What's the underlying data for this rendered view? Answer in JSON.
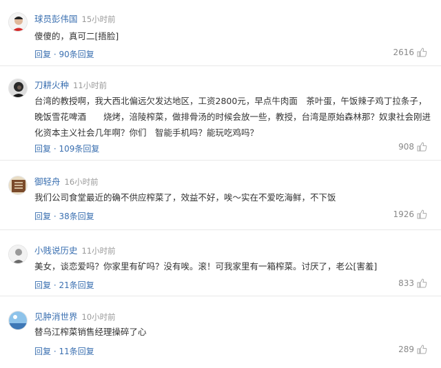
{
  "comments": [
    {
      "username": "球员彭伟国",
      "time": "15小时前",
      "content": "傻傻的，真可二[捂脸]",
      "reply_label": "回复 · 90条回复",
      "likes": "2616",
      "avatar_icon": "person-red-shirt-avatar"
    },
    {
      "username": "刀耕火种",
      "time": "11小时前",
      "content": "台湾的教授啊，我大西北偏远欠发达地区，工资2800元，早点牛肉面　茶叶蛋，午饭辣子鸡丁拉条子，晚饭雪花啤酒　　烧烤，涪陵榨菜，做排骨汤的时候会放一些，教授，台湾是原始森林那？奴隶社会刚进化资本主义社会几年啊？你们　智能手机吗？能玩吃鸡吗？",
      "reply_label": "回复 · 109条回复",
      "likes": "908",
      "avatar_icon": "dark-portrait-avatar"
    },
    {
      "username": "御轻舟",
      "time": "16小时前",
      "content": "我们公司食堂最近的确不供应榨菜了，效益不好，唉～实在不爱吃海鲜，不下饭",
      "reply_label": "回复 · 38条回复",
      "likes": "1926",
      "avatar_icon": "calligraphy-avatar"
    },
    {
      "username": "小贱说历史",
      "time": "11小时前",
      "content": "美女，谈恋爱吗？你家里有矿吗？没有唉。滚！可我家里有一箱榨菜。讨厌了，老公[害羞]",
      "reply_label": "回复 · 21条回复",
      "likes": "833",
      "avatar_icon": "grey-figure-avatar"
    },
    {
      "username": "见肿消世界",
      "time": "10小时前",
      "content": "替乌江榨菜销售经理操碎了心",
      "reply_label": "回复 · 11条回复",
      "likes": "289",
      "avatar_icon": "blue-sky-avatar"
    }
  ],
  "colors": {
    "username": "#3a6fb0",
    "reply": "#3a6fb0",
    "meta": "#999999",
    "divider": "#e8e8e8"
  }
}
